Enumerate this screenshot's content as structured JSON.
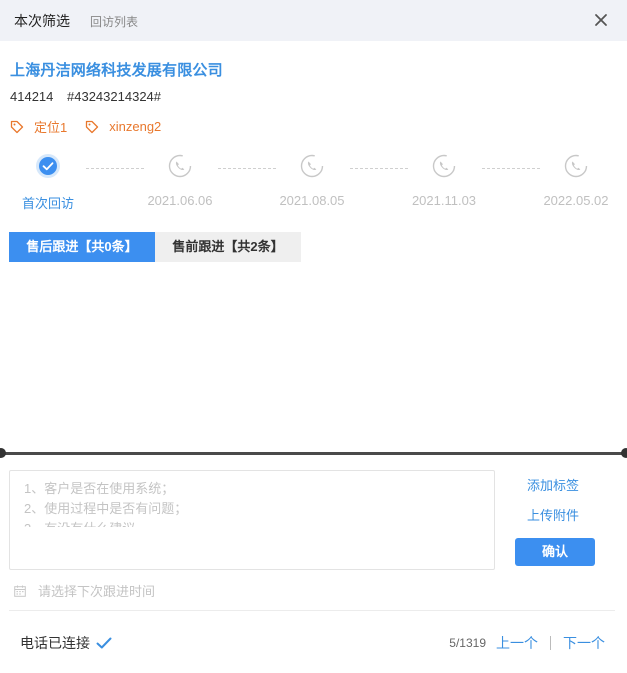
{
  "header": {
    "active_tab": "本次筛选",
    "inactive_tab": "回访列表"
  },
  "company": {
    "name": "上海丹洁网络科技发展有限公司",
    "id": "414214",
    "code": "#43243214324#"
  },
  "tags": [
    "定位1",
    "xinzeng2"
  ],
  "timeline": [
    "首次回访",
    "2021.06.06",
    "2021.08.05",
    "2021.11.03",
    "2022.05.02"
  ],
  "subtabs": {
    "after_sales": "售后跟进【共0条】",
    "pre_sales": "售前跟进【共2条】"
  },
  "note": {
    "lines": [
      "1、客户是否在使用系统；",
      "2、使用过程中是否有问题；",
      "3、有没有什么建议"
    ]
  },
  "actions": {
    "add_tag": "添加标签",
    "upload": "上传附件",
    "confirm": "确认"
  },
  "next_time_placeholder": "请选择下次跟进时间",
  "footer": {
    "status": "电话已连接",
    "page": "5/1319",
    "prev": "上一个",
    "next": "下一个"
  },
  "colors": {
    "accent": "#3a8fe0",
    "tag": "#e8782d",
    "header_bg": "#f0f2f7"
  }
}
